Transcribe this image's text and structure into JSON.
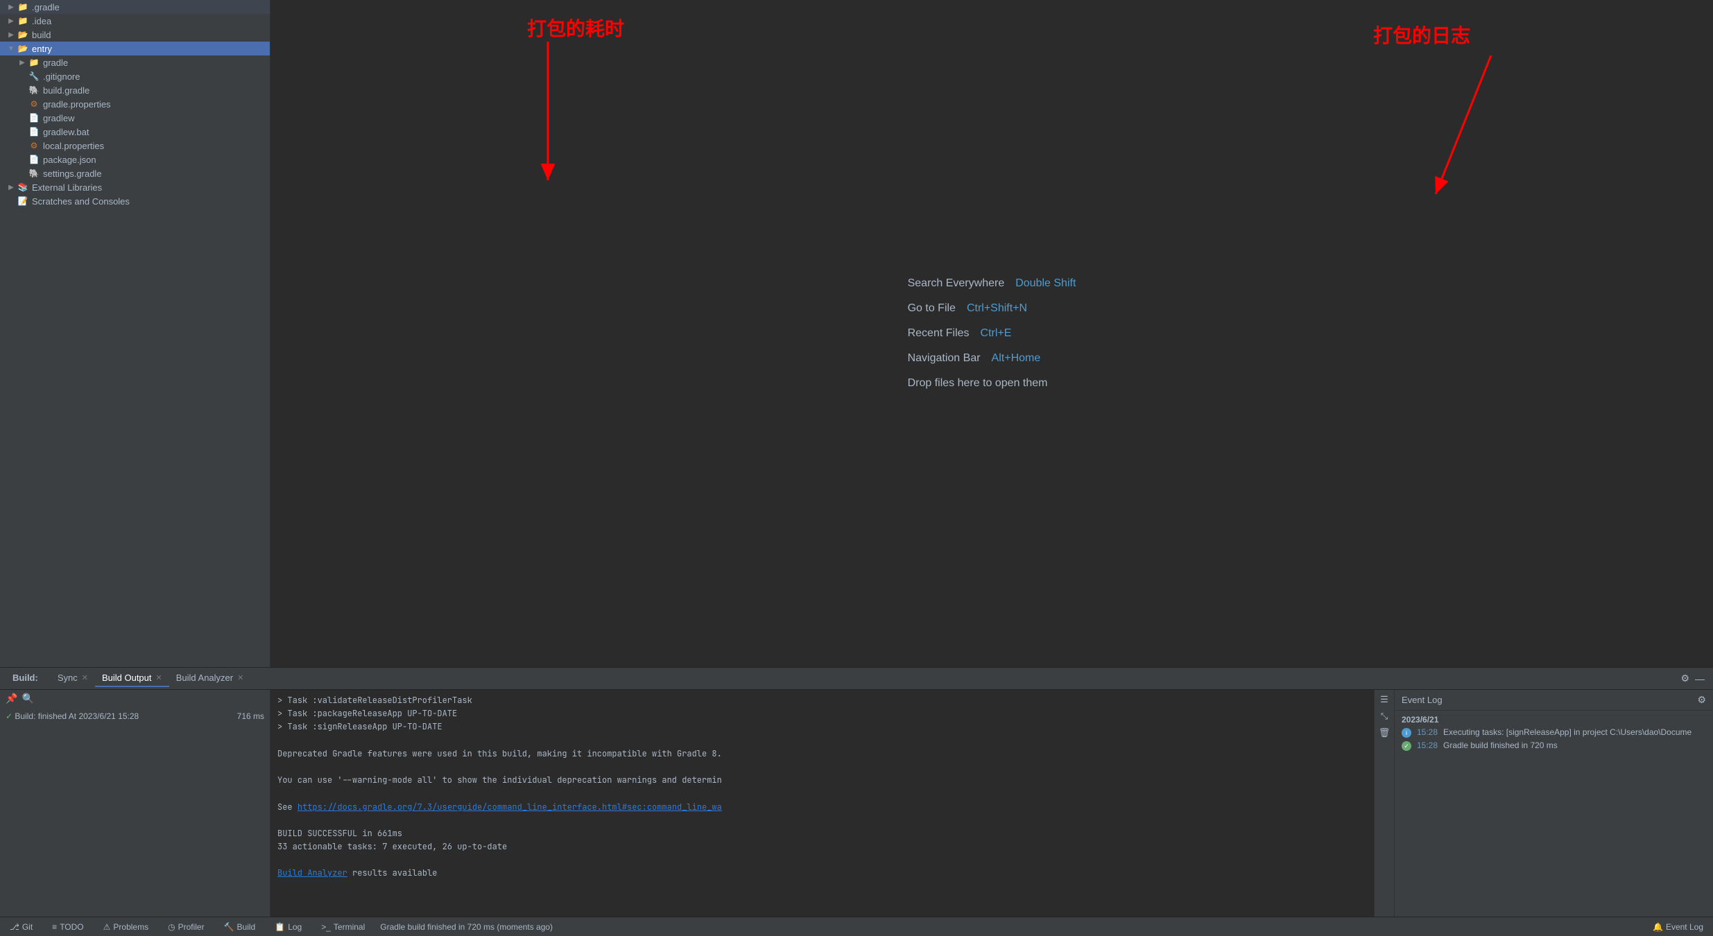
{
  "sidebar": {
    "items": [
      {
        "id": "gradle",
        "label": ".gradle",
        "type": "folder",
        "indent": 0,
        "expanded": false
      },
      {
        "id": "idea",
        "label": ".idea",
        "type": "folder",
        "indent": 0,
        "expanded": false
      },
      {
        "id": "build",
        "label": "build",
        "type": "folder-yellow",
        "indent": 0,
        "expanded": false
      },
      {
        "id": "entry",
        "label": "entry",
        "type": "folder",
        "indent": 0,
        "expanded": true,
        "selected": true
      },
      {
        "id": "gradle2",
        "label": "gradle",
        "type": "folder",
        "indent": 1,
        "expanded": false
      },
      {
        "id": "gitignore",
        "label": ".gitignore",
        "type": "file-git",
        "indent": 1
      },
      {
        "id": "build-gradle",
        "label": "build.gradle",
        "type": "file-gradle",
        "indent": 1
      },
      {
        "id": "gradle-properties",
        "label": "gradle.properties",
        "type": "file-properties",
        "indent": 1
      },
      {
        "id": "gradlew",
        "label": "gradlew",
        "type": "file-script",
        "indent": 1
      },
      {
        "id": "gradlew-bat",
        "label": "gradlew.bat",
        "type": "file-bat",
        "indent": 1
      },
      {
        "id": "local-properties",
        "label": "local.properties",
        "type": "file-local",
        "indent": 1
      },
      {
        "id": "package-json",
        "label": "package.json",
        "type": "file-json",
        "indent": 1
      },
      {
        "id": "settings-gradle",
        "label": "settings.gradle",
        "type": "file-gradle",
        "indent": 1
      },
      {
        "id": "external-libraries",
        "label": "External Libraries",
        "type": "ext-lib",
        "indent": 0,
        "expanded": false
      },
      {
        "id": "scratches",
        "label": "Scratches and Consoles",
        "type": "scratches",
        "indent": 0
      }
    ]
  },
  "editor": {
    "hints": [
      {
        "label": "Search Everywhere",
        "shortcut": "Double Shift"
      },
      {
        "label": "Go to File",
        "shortcut": "Ctrl+Shift+N"
      },
      {
        "label": "Recent Files",
        "shortcut": "Ctrl+E"
      },
      {
        "label": "Navigation Bar",
        "shortcut": "Alt+Home"
      },
      {
        "label": "Drop files here to open them",
        "shortcut": ""
      }
    ]
  },
  "annotations": {
    "build_time_label": "打包的耗时",
    "build_log_label": "打包的日志"
  },
  "bottom_panel": {
    "tabs": [
      {
        "id": "build",
        "label": "Build:",
        "prefix": true
      },
      {
        "id": "sync",
        "label": "Sync",
        "closeable": true
      },
      {
        "id": "build-output",
        "label": "Build Output",
        "closeable": true,
        "active": true
      },
      {
        "id": "build-analyzer",
        "label": "Build Analyzer",
        "closeable": true
      }
    ],
    "build_status": {
      "icon": "✓",
      "text": "Build: finished At 2023/6/21 15:28",
      "duration": "716 ms"
    },
    "output_lines": [
      "> Task :validateReleaseDistProfilerTask",
      "> Task :packageReleaseApp UP-TO-DATE",
      "> Task :signReleaseApp UP-TO-DATE",
      "",
      "Deprecated Gradle features were used in this build, making it incompatible with Gradle 8.",
      "",
      "You can use '--warning-mode all' to show the individual deprecation warnings and determin",
      "",
      "See https://docs.gradle.org/7.3/userguide/command_line_interface.html#sec:command_line_wa",
      "",
      "BUILD SUCCESSFUL in 661ms",
      "33 actionable tasks: 7 executed, 26 up-to-date",
      "",
      "Build Analyzer results available"
    ],
    "link_url": "https://docs.gradle.org/7.3/userguide/command_line_interface.html#sec:command_line_wa",
    "build_analyzer_link": "Build Analyzer"
  },
  "event_log": {
    "title": "Event Log",
    "date": "2023/6/21",
    "events": [
      {
        "time": "15:28",
        "text": "Executing tasks: [signReleaseApp] in project C:\\Users\\dao\\Docume",
        "icon": "info"
      },
      {
        "time": "15:28",
        "text": "Gradle build finished in 720 ms",
        "icon": "ok"
      }
    ]
  },
  "status_bar": {
    "items": [
      {
        "id": "git",
        "icon": "⎇",
        "label": "Git"
      },
      {
        "id": "todo",
        "icon": "≡",
        "label": "TODO"
      },
      {
        "id": "problems",
        "icon": "⚠",
        "label": "Problems"
      },
      {
        "id": "profiler",
        "icon": "◷",
        "label": "Profiler"
      },
      {
        "id": "build-btn",
        "icon": "🔨",
        "label": "Build"
      },
      {
        "id": "log",
        "icon": "📋",
        "label": "Log"
      },
      {
        "id": "terminal",
        "icon": ">_",
        "label": "Terminal"
      }
    ],
    "right": {
      "event_log": "Event Log"
    },
    "bottom_msg": "Gradle build finished in 720 ms (moments ago)"
  }
}
